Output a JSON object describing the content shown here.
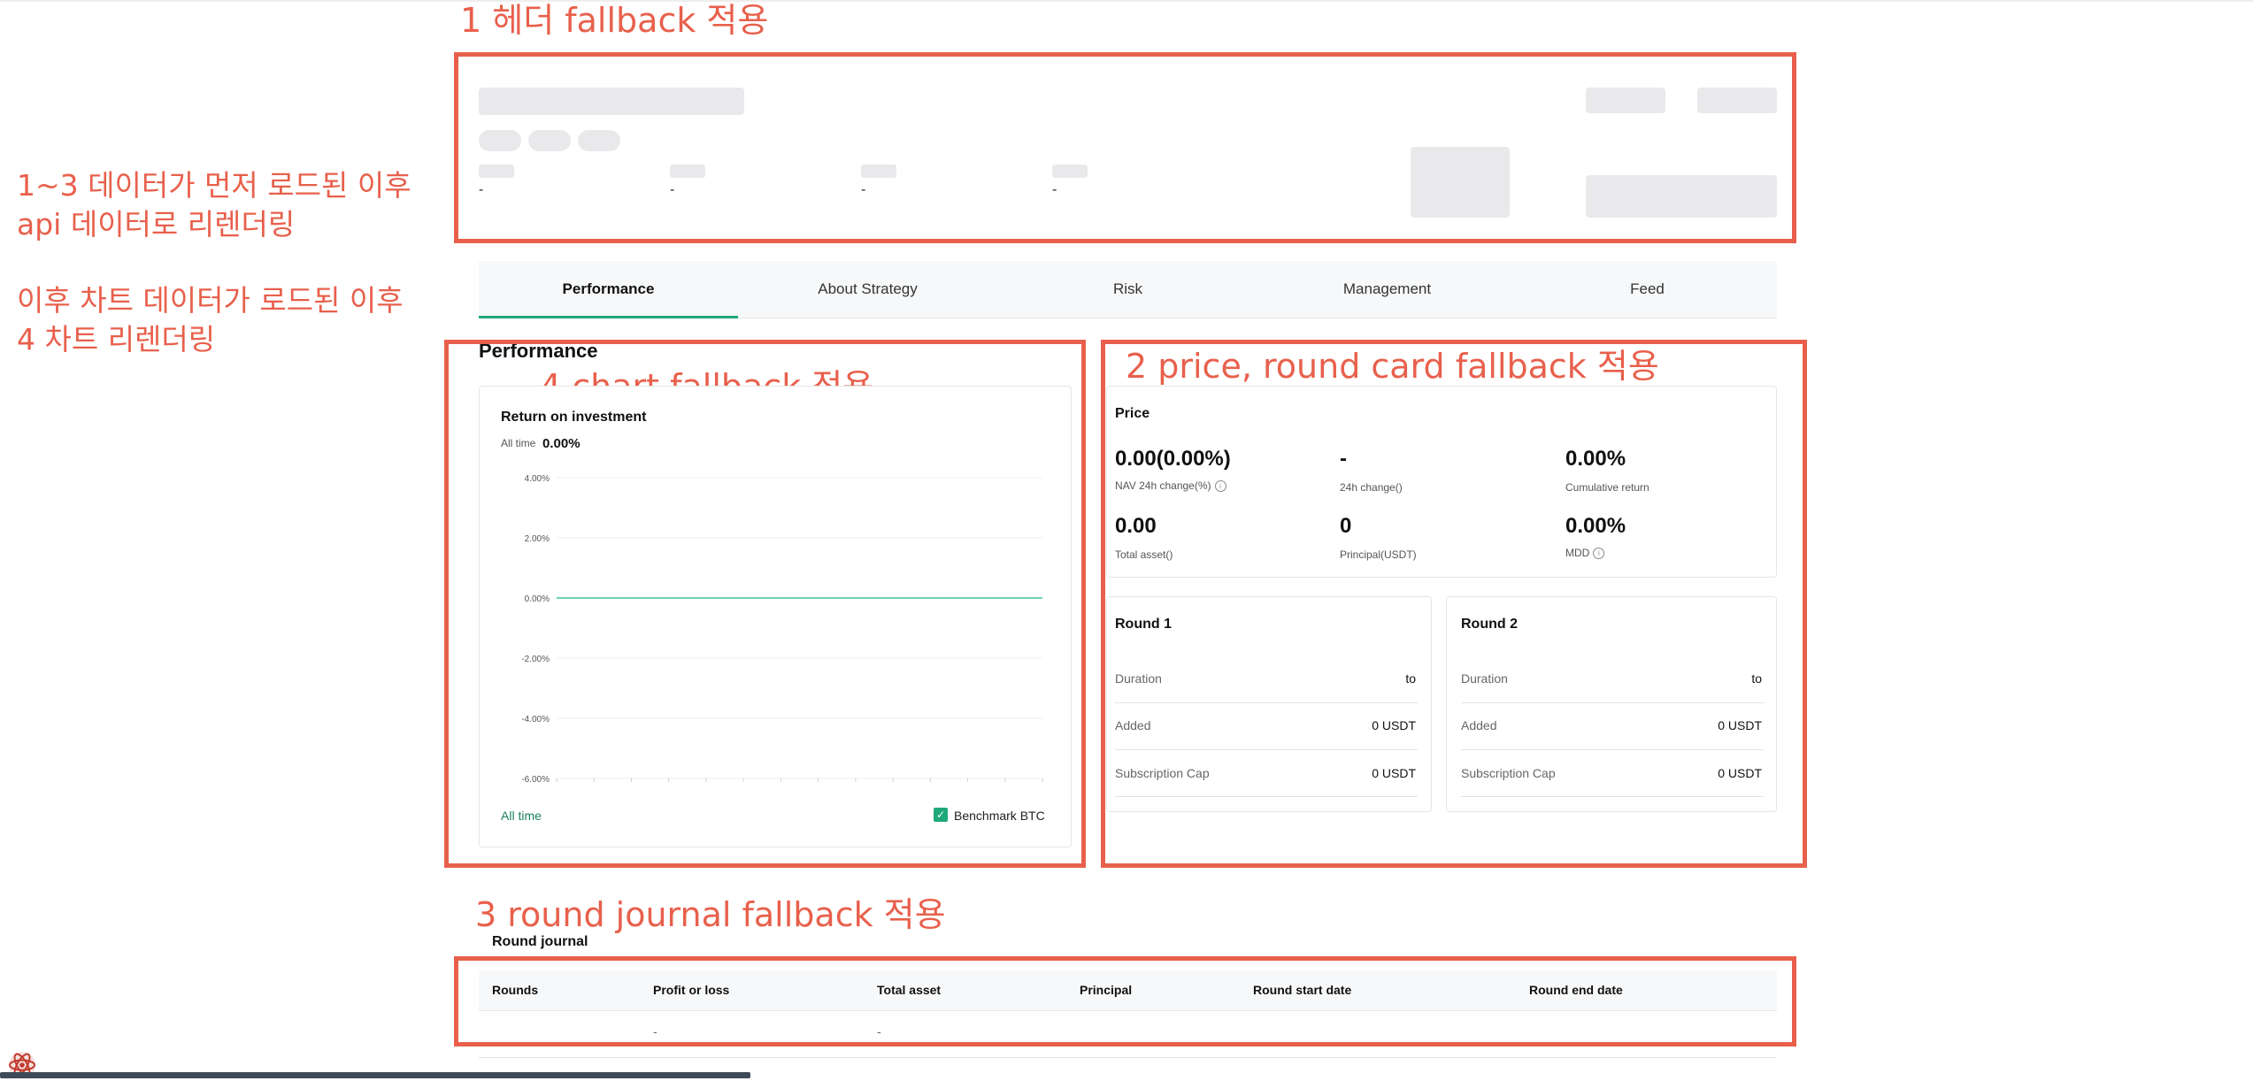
{
  "annotations": {
    "header": "1 헤더 fallback 적용",
    "side_line1": "1~3 데이터가 먼저 로드된 이후",
    "side_line2": "api 데이터로 리렌더링",
    "side_line3": "이후 차트 데이터가 로드된 이후",
    "side_line4": "4 차트 리렌더링",
    "price_round": "2 price, round card fallback 적용",
    "chart": "4 chart fallback 적용",
    "journal": "3 round journal fallback 적용"
  },
  "header": {
    "stats": [
      "-",
      "-",
      "-",
      "-"
    ]
  },
  "tabs": [
    {
      "label": "Performance",
      "active": true
    },
    {
      "label": "About Strategy",
      "active": false
    },
    {
      "label": "Risk",
      "active": false
    },
    {
      "label": "Management",
      "active": false
    },
    {
      "label": "Feed",
      "active": false
    }
  ],
  "section_title": "Performance",
  "chart_card": {
    "title": "Return on investment",
    "period_label": "All time",
    "period_value": "0.00%",
    "footer_left": "All time",
    "benchmark_label": "Benchmark BTC",
    "benchmark_checked": true
  },
  "chart_data": {
    "type": "line",
    "y_ticks": [
      "4.00%",
      "2.00%",
      "0.00%",
      "-2.00%",
      "-4.00%",
      "-6.00%"
    ],
    "ylim": [
      -6,
      4
    ],
    "series": [
      {
        "values": [
          0,
          0
        ]
      }
    ],
    "line_color": "#3ec59b"
  },
  "price_card": {
    "title": "Price",
    "items": [
      {
        "value": "0.00(0.00%)",
        "label": "NAV 24h change(%)",
        "info": true
      },
      {
        "value": "-",
        "label": "24h change()",
        "info": false
      },
      {
        "value": "0.00%",
        "label": "Cumulative return",
        "info": false
      },
      {
        "value": "0.00",
        "label": "Total asset()",
        "info": false
      },
      {
        "value": "0",
        "label": "Principal(USDT)",
        "info": false
      },
      {
        "value": "0.00%",
        "label": "MDD",
        "info": true
      }
    ]
  },
  "rounds": [
    {
      "title": "Round 1",
      "rows": [
        {
          "label": "Duration",
          "value": "to"
        },
        {
          "label": "Added",
          "value": "0 USDT"
        },
        {
          "label": "Subscription Cap",
          "value": "0 USDT"
        }
      ]
    },
    {
      "title": "Round 2",
      "rows": [
        {
          "label": "Duration",
          "value": "to"
        },
        {
          "label": "Added",
          "value": "0 USDT"
        },
        {
          "label": "Subscription Cap",
          "value": "0 USDT"
        }
      ]
    }
  ],
  "journal": {
    "title": "Round journal",
    "headers": [
      "Rounds",
      "Profit or loss",
      "Total asset",
      "Principal",
      "Round start date",
      "Round end date"
    ],
    "row": [
      "",
      "-",
      "-",
      "",
      "",
      ""
    ]
  },
  "colors": {
    "annotation": "#e8604c",
    "accent": "#1fa97b",
    "skeleton": "#e9e9eb"
  }
}
